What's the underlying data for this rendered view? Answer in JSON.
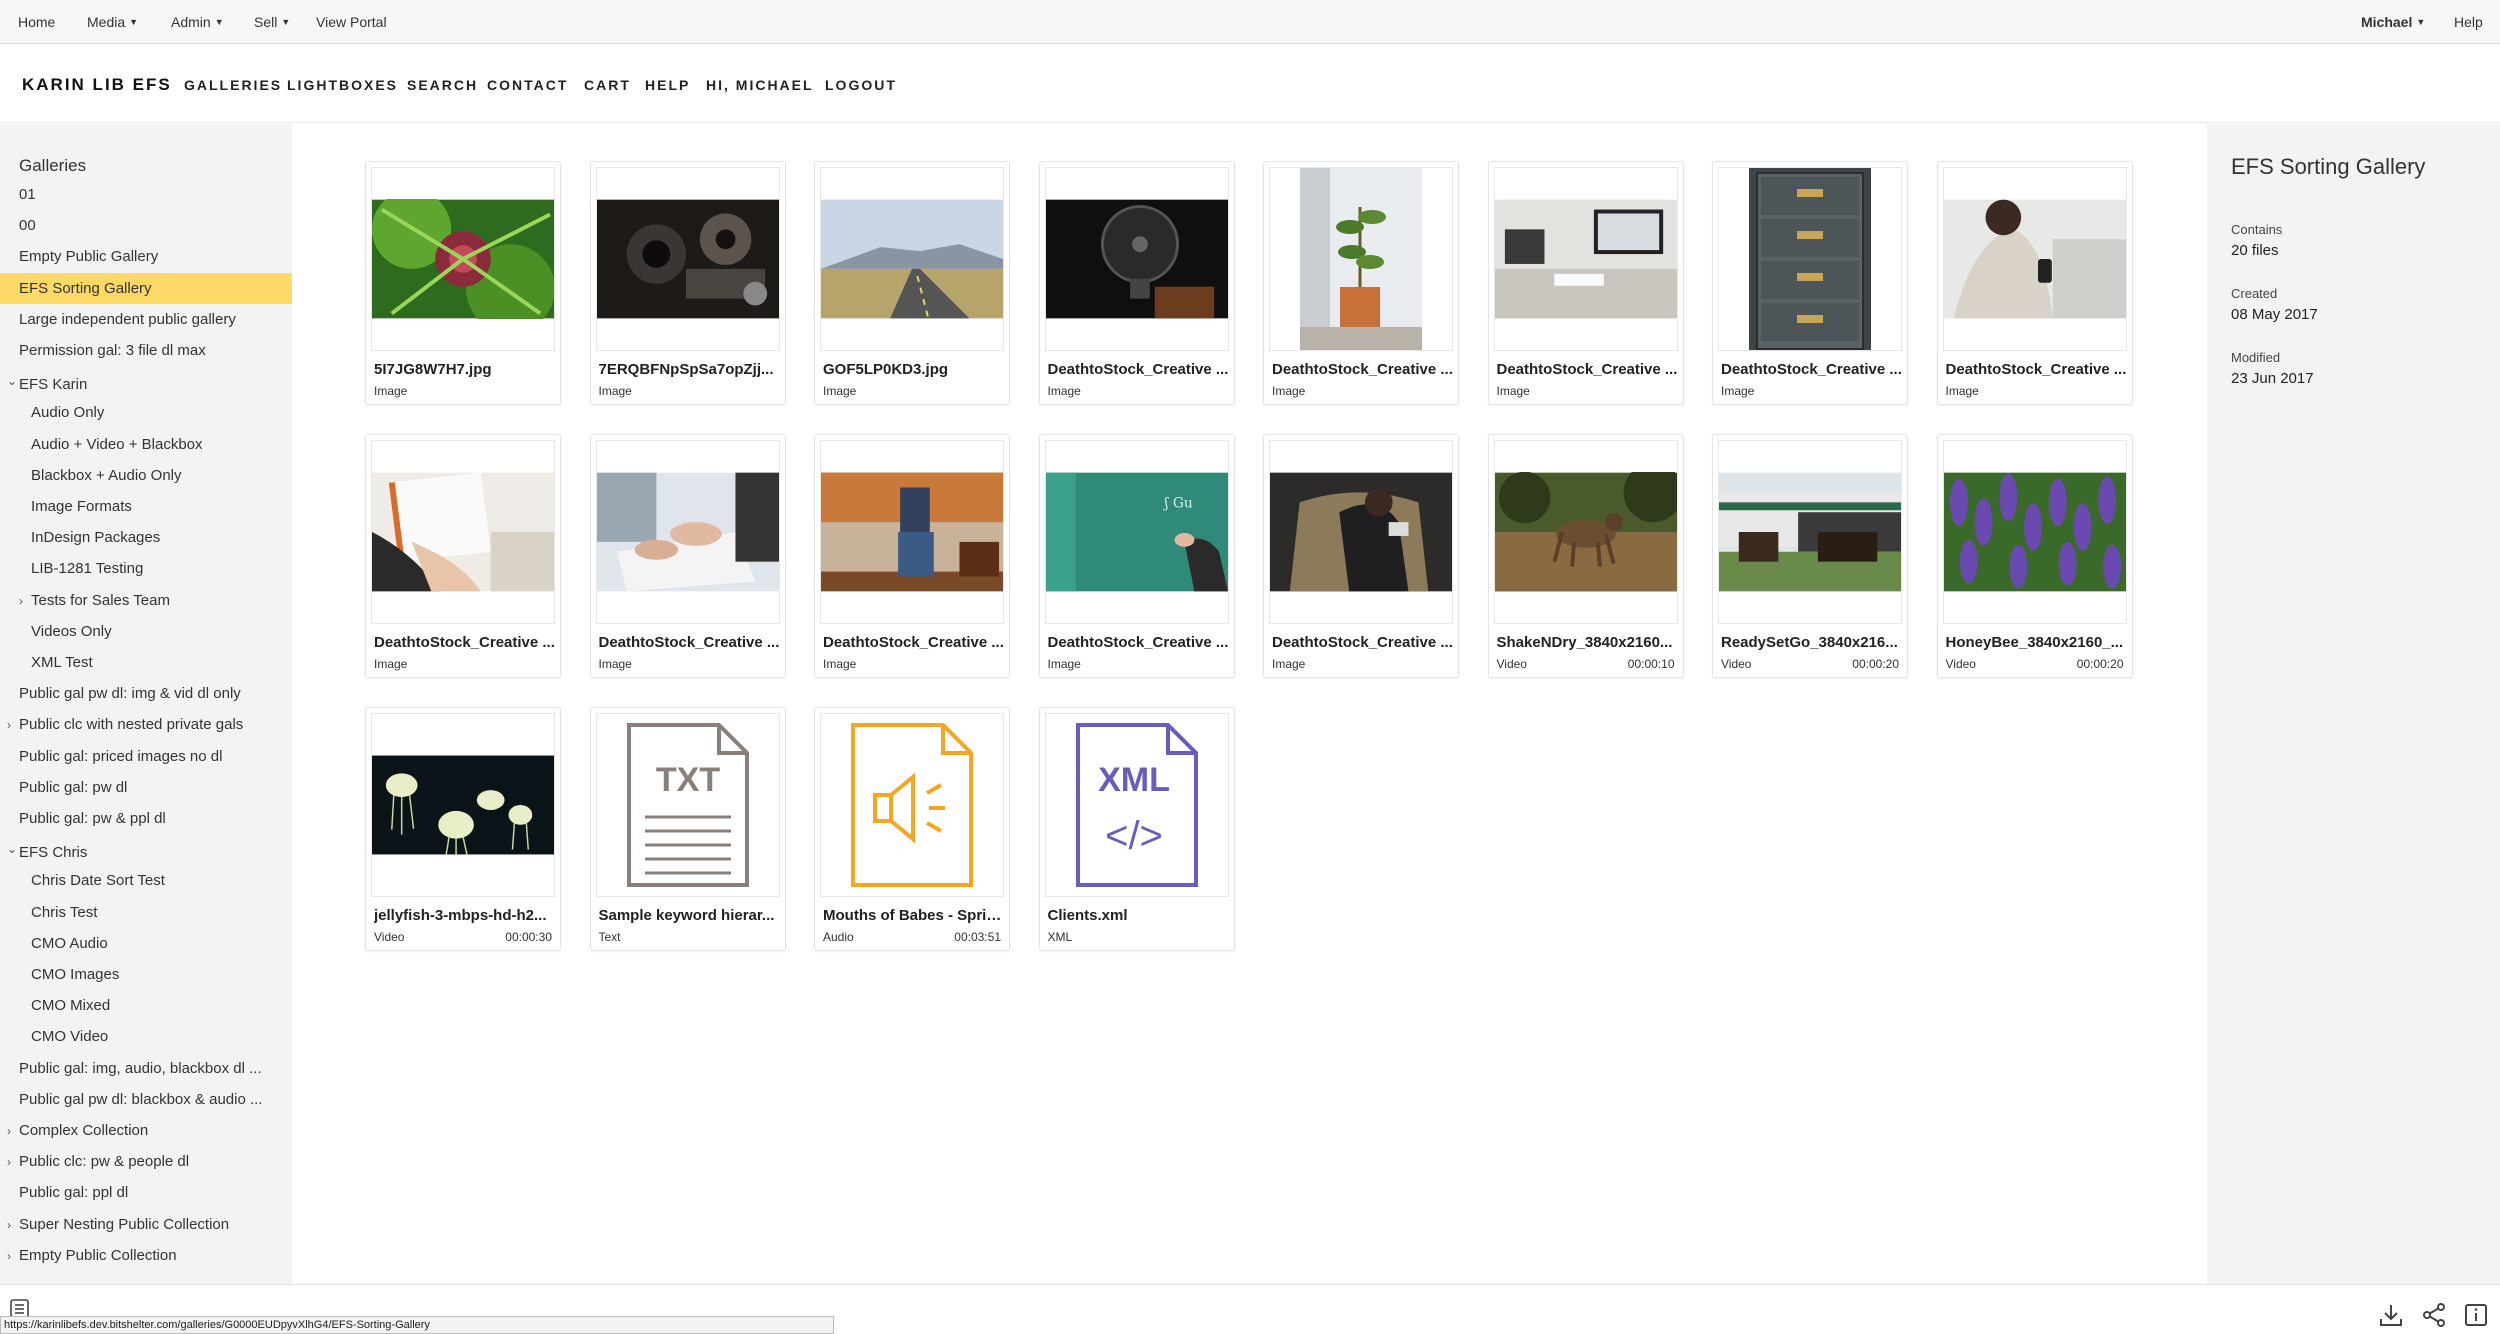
{
  "admin_bar": {
    "home": "Home",
    "media": "Media",
    "admin": "Admin",
    "sell": "Sell",
    "view_portal": "View Portal",
    "user": "Michael",
    "help": "Help"
  },
  "header": {
    "brand": "KARIN LIB EFS",
    "nav": [
      "GALLERIES",
      "LIGHTBOXES",
      "SEARCH",
      "CONTACT",
      "CART",
      "HELP",
      "HI, MICHAEL",
      "LOGOUT"
    ]
  },
  "sidebar": {
    "title": "Galleries",
    "items": [
      {
        "label": "01"
      },
      {
        "label": "00"
      },
      {
        "label": "Empty Public Gallery"
      },
      {
        "label": "EFS Sorting Gallery",
        "selected": true
      },
      {
        "label": "Large independent public gallery"
      },
      {
        "label": "Permission gal: 3 file dl max"
      },
      {
        "label": "EFS Karin",
        "expanded": true
      },
      {
        "label": "Audio Only"
      },
      {
        "label": "Audio + Video + Blackbox"
      },
      {
        "label": "Blackbox + Audio Only"
      },
      {
        "label": "Image Formats"
      },
      {
        "label": "InDesign Packages"
      },
      {
        "label": "LIB-1281 Testing"
      },
      {
        "label": "Tests for Sales Team",
        "collapsed": true
      },
      {
        "label": "Videos Only"
      },
      {
        "label": "XML Test"
      },
      {
        "label": "Public gal pw dl: img & vid dl only"
      },
      {
        "label": "Public clc with nested private gals",
        "collapsed": true
      },
      {
        "label": "Public gal: priced images no dl"
      },
      {
        "label": "Public gal: pw dl"
      },
      {
        "label": "Public gal: pw & ppl dl"
      },
      {
        "label": "EFS Chris",
        "expanded": true
      },
      {
        "label": "Chris Date Sort Test"
      },
      {
        "label": "Chris Test"
      },
      {
        "label": "CMO Audio"
      },
      {
        "label": "CMO Images"
      },
      {
        "label": "CMO Mixed"
      },
      {
        "label": "CMO Video"
      },
      {
        "label": "Public gal: img, audio, blackbox dl ..."
      },
      {
        "label": "Public gal pw dl: blackbox & audio ..."
      },
      {
        "label": "Complex Collection",
        "collapsed": true
      },
      {
        "label": "Public clc: pw & people dl",
        "collapsed": true
      },
      {
        "label": "Public gal: ppl dl"
      },
      {
        "label": "Super Nesting Public Collection",
        "collapsed": true
      },
      {
        "label": "Empty Public Collection",
        "collapsed": true
      }
    ]
  },
  "files": [
    {
      "name": "5I7JG8W7H7.jpg",
      "type": "Image",
      "duration": "",
      "thumb": "ferns"
    },
    {
      "name": "7ERQBFNpSpSa7opZjj...",
      "type": "Image",
      "duration": "",
      "thumb": "projector"
    },
    {
      "name": "GOF5LP0KD3.jpg",
      "type": "Image",
      "duration": "",
      "thumb": "road"
    },
    {
      "name": "DeathtoStock_Creative ...",
      "type": "Image",
      "duration": "",
      "thumb": "fan"
    },
    {
      "name": "DeathtoStock_Creative ...",
      "type": "Image",
      "duration": "",
      "thumb": "plant"
    },
    {
      "name": "DeathtoStock_Creative ...",
      "type": "Image",
      "duration": "",
      "thumb": "desk"
    },
    {
      "name": "DeathtoStock_Creative ...",
      "type": "Image",
      "duration": "",
      "thumb": "cabinet"
    },
    {
      "name": "DeathtoStock_Creative ...",
      "type": "Image",
      "duration": "",
      "thumb": "phone"
    },
    {
      "name": "DeathtoStock_Creative ...",
      "type": "Image",
      "duration": "",
      "thumb": "book"
    },
    {
      "name": "DeathtoStock_Creative ...",
      "type": "Image",
      "duration": "",
      "thumb": "typing"
    },
    {
      "name": "DeathtoStock_Creative ...",
      "type": "Image",
      "duration": "",
      "thumb": "sofa"
    },
    {
      "name": "DeathtoStock_Creative ...",
      "type": "Image",
      "duration": "",
      "thumb": "chalkboard"
    },
    {
      "name": "DeathtoStock_Creative ...",
      "type": "Image",
      "duration": "",
      "thumb": "chair"
    },
    {
      "name": "ShakeNDry_3840x2160...",
      "type": "Video",
      "duration": "00:00:10",
      "thumb": "dog"
    },
    {
      "name": "ReadySetGo_3840x216...",
      "type": "Video",
      "duration": "00:00:20",
      "thumb": "horses"
    },
    {
      "name": "HoneyBee_3840x2160_...",
      "type": "Video",
      "duration": "00:00:20",
      "thumb": "flowers"
    },
    {
      "name": "jellyfish-3-mbps-hd-h2...",
      "type": "Video",
      "duration": "00:00:30",
      "thumb": "jellyfish"
    },
    {
      "name": "Sample keyword hierar...",
      "type": "Text",
      "duration": "",
      "thumb": "txt-file"
    },
    {
      "name": "Mouths of Babes - Sprin...",
      "type": "Audio",
      "duration": "00:03:51",
      "thumb": "audio-file"
    },
    {
      "name": "Clients.xml",
      "type": "XML",
      "duration": "",
      "thumb": "xml-file"
    }
  ],
  "file_icons": {
    "txt": "TXT",
    "xml": "XML",
    "xml_code": "</>"
  },
  "info": {
    "title": "EFS Sorting Gallery",
    "contains_label": "Contains",
    "contains_value": "20 files",
    "created_label": "Created",
    "created_value": "08 May 2017",
    "modified_label": "Modified",
    "modified_value": "23 Jun 2017"
  },
  "status_url": "https://karinlibefs.dev.bitshelter.com/galleries/G0000EUDpyvXlhG4/EFS-Sorting-Gallery",
  "colors": {
    "selected": "#ffd966",
    "txt_icon": "#8a807b",
    "audio_icon": "#f5a623",
    "xml_icon": "#6b5bbd"
  }
}
